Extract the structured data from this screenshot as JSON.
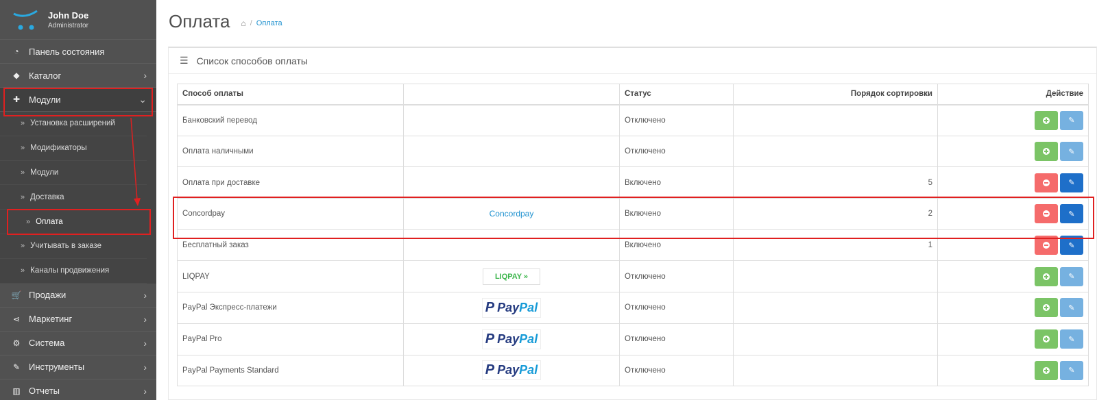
{
  "profile": {
    "name": "John Doe",
    "role": "Administrator"
  },
  "sidebar": {
    "items": [
      {
        "label": "Панель состояния",
        "icon": "dashboard-icon"
      },
      {
        "label": "Каталог",
        "icon": "tags-icon"
      },
      {
        "label": "Модули",
        "icon": "puzzle-icon"
      }
    ],
    "subitems": [
      {
        "label": "Установка расширений"
      },
      {
        "label": "Модификаторы"
      },
      {
        "label": "Модули"
      },
      {
        "label": "Доставка"
      },
      {
        "label": "Оплата"
      },
      {
        "label": "Учитывать в заказе"
      },
      {
        "label": "Каналы продвижения"
      }
    ],
    "items_after": [
      {
        "label": "Продажи",
        "icon": "cart-icon"
      },
      {
        "label": "Маркетинг",
        "icon": "share-icon"
      },
      {
        "label": "Система",
        "icon": "gear-icon"
      },
      {
        "label": "Инструменты",
        "icon": "wrench-icon"
      },
      {
        "label": "Отчеты",
        "icon": "bar-chart-icon"
      }
    ]
  },
  "header": {
    "title": "Оплата",
    "breadcrumb": "Оплата"
  },
  "panel": {
    "title": "Список способов оплаты"
  },
  "table": {
    "headers": [
      "Способ оплаты",
      "",
      "Статус",
      "Порядок сортировки",
      "Действие"
    ],
    "rows": [
      {
        "name": "Банковский перевод",
        "image": "",
        "status": "Отключено",
        "sort": "",
        "installed": false
      },
      {
        "name": "Оплата наличными",
        "image": "",
        "status": "Отключено",
        "sort": "",
        "installed": false
      },
      {
        "name": "Оплата при доставке",
        "image": "",
        "status": "Включено",
        "sort": "5",
        "installed": true
      },
      {
        "name": "Concordpay",
        "image": "Concordpay",
        "status": "Включено",
        "sort": "2",
        "installed": true
      },
      {
        "name": "Бесплатный заказ",
        "image": "",
        "status": "Включено",
        "sort": "1",
        "installed": true
      },
      {
        "name": "LIQPAY",
        "image": "LIQPAY",
        "status": "Отключено",
        "sort": "",
        "installed": false
      },
      {
        "name": "PayPal Экспресс-платежи",
        "image": "PayPal",
        "status": "Отключено",
        "sort": "",
        "installed": false
      },
      {
        "name": "PayPal Pro",
        "image": "PayPal",
        "status": "Отключено",
        "sort": "",
        "installed": false
      },
      {
        "name": "PayPal Payments Standard",
        "image": "PayPal",
        "status": "Отключено",
        "sort": "",
        "installed": false
      }
    ]
  },
  "logos": {
    "liqpay": "LIQPAY",
    "paypal_pay": "Pay",
    "paypal_pal": "Pal"
  },
  "colors": {
    "install": "#7bc466",
    "uninstall": "#f56b6b",
    "edit_disabled": "#76b1e0",
    "edit": "#1e6fc9",
    "highlight": "#e02020"
  }
}
